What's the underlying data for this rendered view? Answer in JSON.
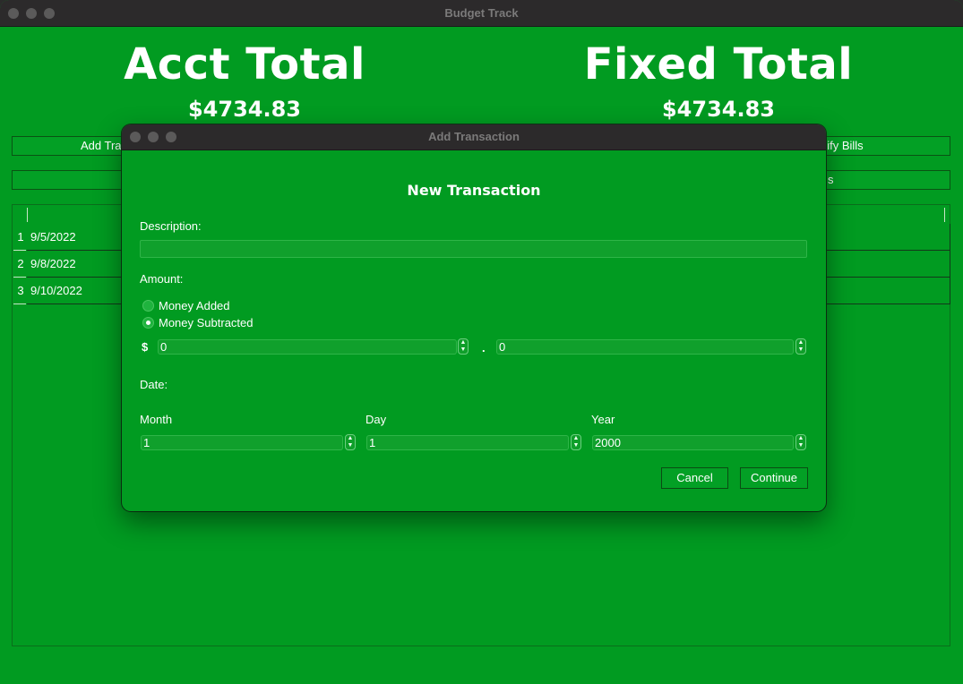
{
  "app": {
    "title": "Budget Track",
    "acct_total_label": "Acct Total",
    "acct_total_value": "$4734.83",
    "fixed_total_label": "Fixed Total",
    "fixed_total_value": "$4734.83",
    "add_button_visible": "Add Tra",
    "modify_bills_visible": "dify Bills",
    "second_right_visible": "s",
    "rows": [
      {
        "num": "1",
        "date": "9/5/2022"
      },
      {
        "num": "2",
        "date": "9/8/2022"
      },
      {
        "num": "3",
        "date": "9/10/2022"
      }
    ]
  },
  "dialog": {
    "title": "Add Transaction",
    "heading": "New Transaction",
    "description_label": "Description:",
    "description_value": "",
    "amount_label": "Amount:",
    "radio_added": "Money Added",
    "radio_subtracted": "Money Subtracted",
    "selected_radio": "Money Subtracted",
    "currency_symbol": "$",
    "dollars_value": "0",
    "decimal_point": ".",
    "cents_value": "0",
    "date_label": "Date:",
    "month_label": "Month",
    "day_label": "Day",
    "year_label": "Year",
    "month_value": "1",
    "day_value": "1",
    "year_value": "2000",
    "cancel_label": "Cancel",
    "continue_label": "Continue"
  },
  "colors": {
    "background": "#019b21",
    "titlebar": "#2c2a2b"
  }
}
